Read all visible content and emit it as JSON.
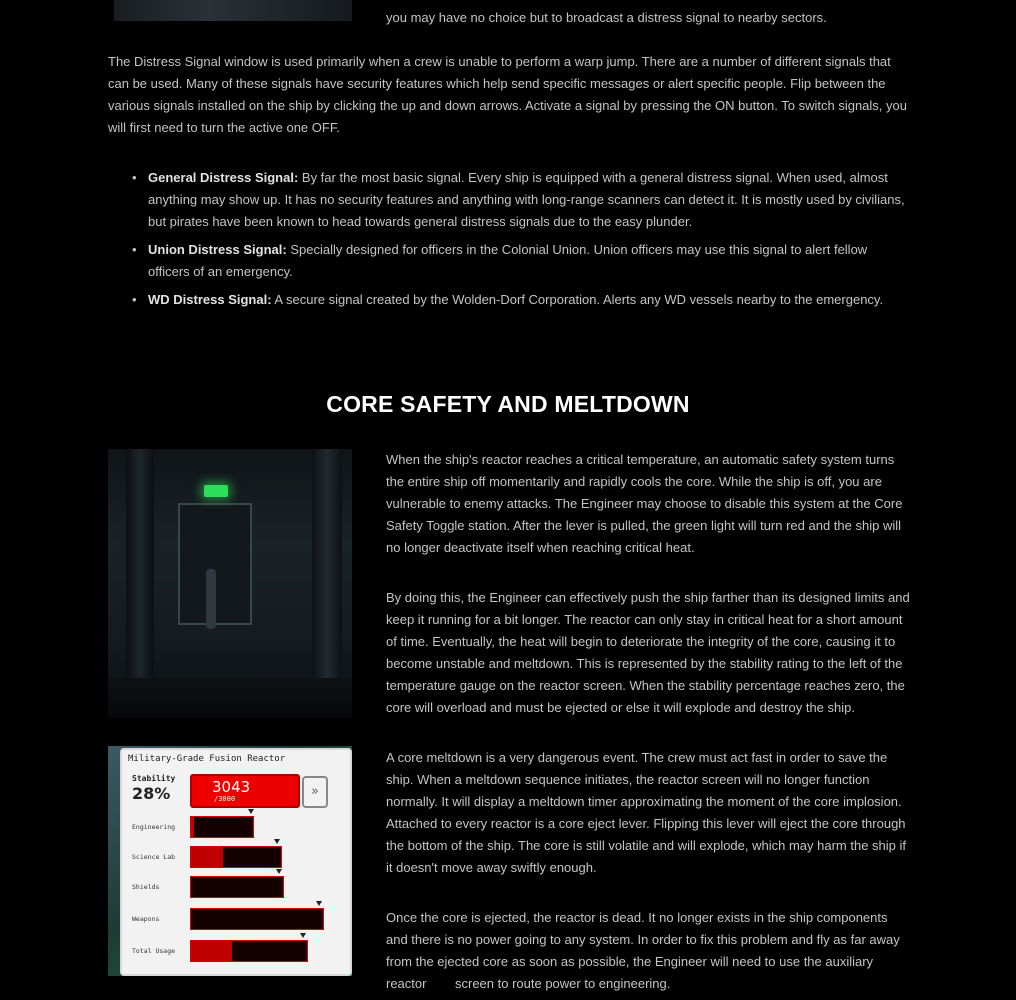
{
  "top": {
    "text": "you may have no choice but to broadcast a distress signal to nearby sectors."
  },
  "intro": "The Distress Signal window is used primarily when a crew is unable to perform a warp jump. There are a number of different signals that can be used. Many of these signals have security features which help send specific messages or alert specific people. Flip between the various signals installed on the ship by clicking the up and down arrows. Activate a signal by pressing the ON button. To switch signals, you will first need to turn the active one OFF.",
  "signals": [
    {
      "name": "General Distress Signal:",
      "desc": " By far the most basic signal. Every ship is equipped with a general distress signal. When used, almost anything may show up. It has no security features and anything with long-range scanners can detect it. It is mostly used by civilians, but pirates have been known to head towards general distress signals due to the easy plunder."
    },
    {
      "name": "Union Distress Signal:",
      "desc": " Specially designed for officers in the Colonial Union. Union officers may use this signal to alert fellow officers of an emergency."
    },
    {
      "name": "WD Distress Signal:",
      "desc": " A secure signal created by the Wolden-Dorf Corporation. Alerts any WD vessels nearby to the emergency."
    }
  ],
  "section_title": "CORE SAFETY AND MELTDOWN",
  "paragraphs": [
    "When the ship's reactor reaches a critical temperature, an automatic safety system turns the entire ship off momentarily and rapidly cools the core. While the ship is off, you are vulnerable to enemy attacks. The Engineer may choose to disable this system at the Core Safety Toggle station. After the lever is pulled, the green light will turn red and the ship will no longer deactivate itself when reaching critical heat.",
    "By doing this, the Engineer can effectively push the ship farther than its designed limits and keep it running for a bit longer. The reactor can only stay in critical heat for a short amount of time. Eventually, the heat will begin to deteriorate the integrity of the core, causing it to become unstable and meltdown. This is represented by the stability rating to the left of the temperature gauge on the reactor screen. When the stability percentage reaches zero, the core will overload and must be ejected or else it will explode and destroy the ship.",
    "A core meltdown is a very dangerous event. The crew must act fast in order to save the ship. When a meltdown sequence initiates, the reactor screen will no longer function normally. It will display a meltdown timer approximating the moment of the core implosion. Attached to every reactor is a core eject lever. Flipping this lever will eject the core through the bottom of the ship. The core is still volatile and will explode, which may harm the ship if it doesn't move away swiftly enough.",
    "Once the core is ejected, the reactor is dead. It no longer exists in the ship components and there is no power going to any system. In order to fix this problem and fly as far away from the ejected core as soon as possible, the Engineer will need to use the auxiliary reactor"
  ],
  "last_line": "screen to route power to engineering.",
  "reactor_screen": {
    "title": "Military-Grade Fusion Reactor",
    "stability_label": "Stability",
    "stability_value": "28%",
    "temperature": "3043",
    "temperature_max": "/3000",
    "forward_icon": "double-chevron-right-icon",
    "rows": [
      {
        "label": "Engineering",
        "fill": 0.05
      },
      {
        "label": "Science Lab",
        "fill": 0.35
      },
      {
        "label": "Shields",
        "fill": 0.0
      },
      {
        "label": "Weapons",
        "fill": 0.0
      },
      {
        "label": "Total Usage",
        "fill": 0.35
      }
    ]
  }
}
